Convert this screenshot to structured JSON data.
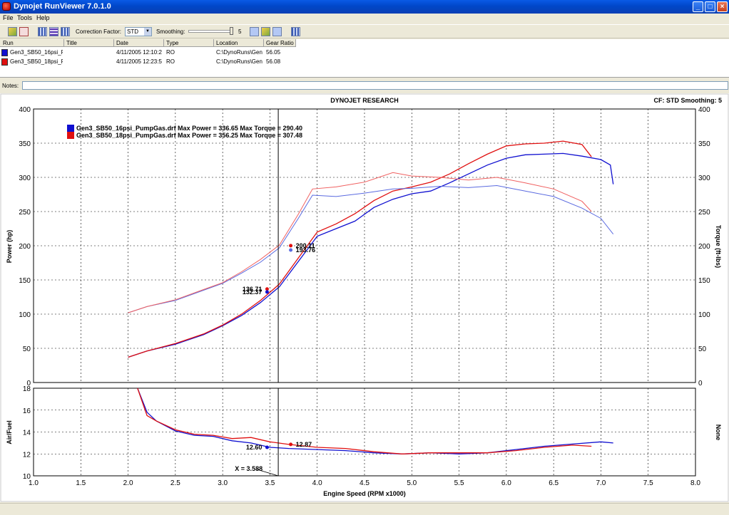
{
  "window": {
    "title": "Dynojet RunViewer 7.0.1.0",
    "min_glyph": "_",
    "max_glyph": "□",
    "close_glyph": "×"
  },
  "menu": {
    "items": [
      "File",
      "Tools",
      "Help"
    ]
  },
  "toolbar": {
    "correction_label": "Correction Factor:",
    "correction_value": "STD",
    "smoothing_label": "Smoothing:",
    "smoothing_value": "5"
  },
  "runs": {
    "headers": [
      "Run",
      "Title",
      "Date",
      "Type",
      "Location",
      "Gear Ratio"
    ],
    "rows": [
      {
        "run": "Gen3_SB50_16psi_F",
        "title": "",
        "date": "4/11/2005 12:10:2",
        "type": "RO",
        "location": "C:\\DynoRuns\\Gen",
        "gear": "56.05",
        "color": "#1010d0"
      },
      {
        "run": "Gen3_SB50_18psi_F",
        "title": "",
        "date": "4/11/2005 12:23:5",
        "type": "RO",
        "location": "C:\\DynoRuns\\Gen",
        "gear": "56.08",
        "color": "#e01010"
      }
    ]
  },
  "notes": {
    "label": "Notes:",
    "value": ""
  },
  "chart_data": {
    "type": "line",
    "title": "DYNOJET RESEARCH",
    "header_right": "CF: STD   Smoothing: 5",
    "xlabel": "Engine Speed (RPM x1000)",
    "xlim": [
      1.0,
      8.0
    ],
    "xticks": [
      "1.0",
      "1.5",
      "2.0",
      "2.5",
      "3.0",
      "3.5",
      "4.0",
      "4.5",
      "5.0",
      "5.5",
      "6.0",
      "6.5",
      "7.0",
      "7.5",
      "8.0"
    ],
    "top": {
      "ylabel": "Power (hp)",
      "ylabel_right": "Torque (ft-lbs)",
      "ylim": [
        0,
        400
      ],
      "yticks": [
        "0",
        "50",
        "100",
        "150",
        "200",
        "250",
        "300",
        "350",
        "400"
      ],
      "legend": [
        {
          "text": "Gen3_SB50_16psi_PumpGas.drf Max Power = 336.65 Max Torque = 290.40",
          "color": "#1010d0"
        },
        {
          "text": "Gen3_SB50_18psi_PumpGas.drf Max Power = 356.25 Max Torque = 307.48",
          "color": "#e01010"
        }
      ],
      "series": [
        {
          "name": "Gen3_SB50_16psi_PumpGas.drf",
          "color": "#1010d0",
          "kind": "power",
          "x": [
            2.0,
            2.2,
            2.5,
            2.8,
            3.0,
            3.2,
            3.4,
            3.6,
            3.8,
            4.0,
            4.2,
            4.4,
            4.6,
            4.8,
            5.0,
            5.2,
            5.4,
            5.6,
            5.8,
            6.0,
            6.2,
            6.4,
            6.6,
            6.8,
            7.0,
            7.1,
            7.13
          ],
          "y": [
            37,
            46,
            56,
            70,
            83,
            98,
            117,
            140,
            177,
            214,
            225,
            236,
            256,
            268,
            276,
            280,
            292,
            305,
            318,
            328,
            333,
            334,
            335,
            331,
            326,
            318,
            290
          ]
        },
        {
          "name": "Gen3_SB50_18psi_PumpGas.drf",
          "color": "#e01010",
          "kind": "power",
          "x": [
            2.0,
            2.2,
            2.5,
            2.8,
            3.0,
            3.2,
            3.4,
            3.6,
            3.8,
            4.0,
            4.2,
            4.4,
            4.6,
            4.8,
            5.0,
            5.2,
            5.4,
            5.6,
            5.8,
            6.0,
            6.2,
            6.4,
            6.6,
            6.8,
            6.9
          ],
          "y": [
            37,
            46,
            57,
            71,
            84,
            100,
            120,
            144,
            182,
            220,
            232,
            247,
            266,
            280,
            286,
            293,
            305,
            320,
            334,
            346,
            349,
            350,
            353,
            348,
            330
          ]
        },
        {
          "name": "Gen3_SB50_16psi_PumpGas.drf",
          "color": "#5a6ae0",
          "kind": "torque",
          "x": [
            2.0,
            2.2,
            2.5,
            2.8,
            3.0,
            3.2,
            3.4,
            3.6,
            3.8,
            3.95,
            4.2,
            4.5,
            4.8,
            5.0,
            5.3,
            5.6,
            5.9,
            6.2,
            6.5,
            6.8,
            7.0,
            7.13
          ],
          "y": [
            102,
            111,
            120,
            135,
            145,
            160,
            176,
            197,
            240,
            274,
            272,
            277,
            283,
            284,
            287,
            285,
            288,
            280,
            272,
            255,
            240,
            217
          ]
        },
        {
          "name": "Gen3_SB50_18psi_PumpGas.drf",
          "color": "#f06060",
          "kind": "torque",
          "x": [
            2.0,
            2.2,
            2.5,
            2.8,
            3.0,
            3.2,
            3.4,
            3.6,
            3.8,
            3.95,
            4.2,
            4.5,
            4.8,
            5.0,
            5.3,
            5.6,
            5.9,
            6.2,
            6.5,
            6.8,
            6.9
          ],
          "y": [
            102,
            111,
            121,
            136,
            146,
            162,
            180,
            201,
            246,
            283,
            286,
            293,
            307,
            302,
            300,
            296,
            300,
            292,
            283,
            265,
            250
          ]
        }
      ],
      "cursor_x": 3.588,
      "markers": [
        {
          "x": 3.72,
          "y": 200.11,
          "label": "200.11",
          "color": "#e01010",
          "side": "right"
        },
        {
          "x": 3.72,
          "y": 193.76,
          "label": "193.76",
          "color": "#5a6ae0",
          "side": "right"
        },
        {
          "x": 3.47,
          "y": 136.71,
          "label": "136.71",
          "color": "#e01010",
          "side": "left"
        },
        {
          "x": 3.47,
          "y": 132.37,
          "label": "132.37",
          "color": "#1010d0",
          "side": "left"
        }
      ]
    },
    "bottom": {
      "ylabel": "Air/Fuel",
      "ylabel_right": "None",
      "ylim": [
        10,
        18
      ],
      "yticks": [
        "10",
        "12",
        "14",
        "16",
        "18"
      ],
      "series": [
        {
          "name": "Gen3_SB50_16psi_PumpGas.drf",
          "color": "#1010d0",
          "x": [
            2.1,
            2.2,
            2.3,
            2.5,
            2.7,
            2.9,
            3.1,
            3.3,
            3.5,
            3.7,
            4.0,
            4.3,
            4.6,
            4.9,
            5.2,
            5.5,
            5.8,
            6.1,
            6.4,
            6.7,
            7.0,
            7.13
          ],
          "y": [
            18,
            15.8,
            15,
            14.1,
            13.7,
            13.6,
            13.2,
            13.0,
            12.6,
            12.5,
            12.4,
            12.3,
            12.1,
            12.0,
            12.1,
            12.0,
            12.1,
            12.4,
            12.7,
            12.9,
            13.1,
            13.0
          ]
        },
        {
          "name": "Gen3_SB50_18psi_PumpGas.drf",
          "color": "#e01010",
          "x": [
            2.1,
            2.2,
            2.3,
            2.5,
            2.7,
            2.9,
            3.1,
            3.3,
            3.5,
            3.7,
            4.0,
            4.3,
            4.6,
            4.9,
            5.2,
            5.5,
            5.8,
            6.1,
            6.4,
            6.7,
            6.9
          ],
          "y": [
            18,
            15.5,
            15.0,
            14.2,
            13.8,
            13.7,
            13.4,
            13.5,
            13.1,
            12.87,
            12.6,
            12.5,
            12.2,
            12.0,
            12.1,
            12.1,
            12.1,
            12.3,
            12.6,
            12.8,
            12.7
          ]
        }
      ],
      "markers": [
        {
          "x": 3.72,
          "y": 12.87,
          "label": "12.87",
          "color": "#e01010",
          "side": "right"
        },
        {
          "x": 3.47,
          "y": 12.6,
          "label": "12.60",
          "color": "#1010d0",
          "side": "left"
        }
      ],
      "cursor_label": "X = 3.588"
    }
  }
}
